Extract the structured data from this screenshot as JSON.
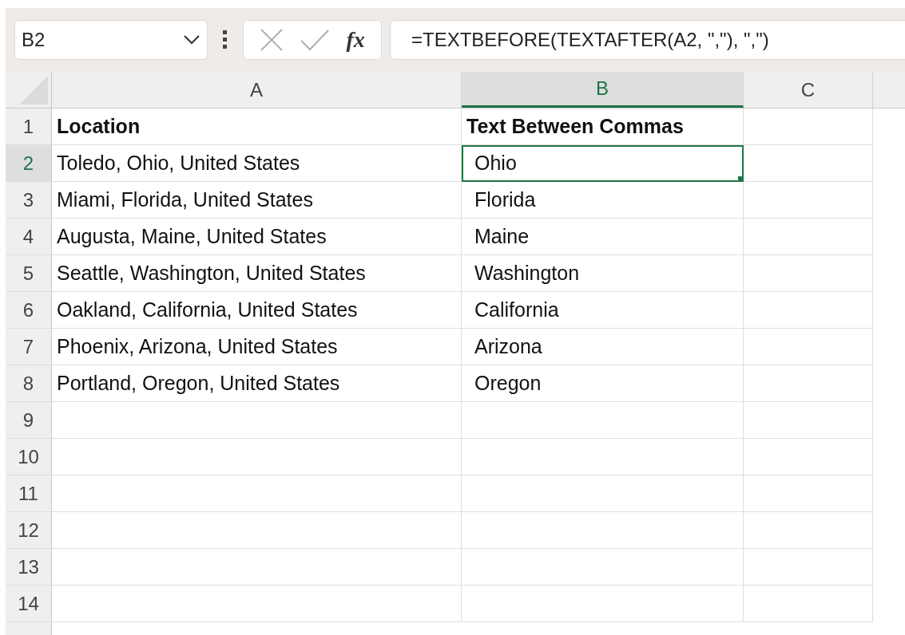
{
  "name_box": {
    "value": "B2"
  },
  "formula_bar": {
    "cancel_disabled": true,
    "enter_disabled": true,
    "function_label": "fx",
    "value": "=TEXTBEFORE(TEXTAFTER(A2, \",\"), \",\")"
  },
  "columns": [
    {
      "label": "A",
      "selected": false
    },
    {
      "label": "B",
      "selected": true
    },
    {
      "label": "C",
      "selected": false
    }
  ],
  "rows": [
    {
      "number": "1",
      "selected": false,
      "cells": [
        {
          "text": "Location",
          "selected": false,
          "bold": true
        },
        {
          "text": "Text Between Commas",
          "selected": false,
          "bold": true
        }
      ]
    },
    {
      "number": "2",
      "selected": true,
      "cells": [
        {
          "text": "Toledo, Ohio, United States",
          "selected": false,
          "bold": false
        },
        {
          "text": "Ohio",
          "selected": true,
          "bold": false
        }
      ]
    },
    {
      "number": "3",
      "selected": false,
      "cells": [
        {
          "text": "Miami, Florida, United States",
          "selected": false,
          "bold": false
        },
        {
          "text": "Florida",
          "selected": false,
          "bold": false
        }
      ]
    },
    {
      "number": "4",
      "selected": false,
      "cells": [
        {
          "text": "Augusta, Maine, United States",
          "selected": false,
          "bold": false
        },
        {
          "text": "Maine",
          "selected": false,
          "bold": false
        }
      ]
    },
    {
      "number": "5",
      "selected": false,
      "cells": [
        {
          "text": "Seattle, Washington, United States",
          "selected": false,
          "bold": false
        },
        {
          "text": "Washington",
          "selected": false,
          "bold": false
        }
      ]
    },
    {
      "number": "6",
      "selected": false,
      "cells": [
        {
          "text": "Oakland, California, United States",
          "selected": false,
          "bold": false
        },
        {
          "text": "California",
          "selected": false,
          "bold": false
        }
      ]
    },
    {
      "number": "7",
      "selected": false,
      "cells": [
        {
          "text": "Phoenix, Arizona, United States",
          "selected": false,
          "bold": false
        },
        {
          "text": "Arizona",
          "selected": false,
          "bold": false
        }
      ]
    },
    {
      "number": "8",
      "selected": false,
      "cells": [
        {
          "text": "Portland, Oregon, United States",
          "selected": false,
          "bold": false
        },
        {
          "text": "Oregon",
          "selected": false,
          "bold": false
        }
      ]
    },
    {
      "number": "9",
      "selected": false,
      "cells": []
    },
    {
      "number": "10",
      "selected": false,
      "cells": []
    },
    {
      "number": "11",
      "selected": false,
      "cells": []
    },
    {
      "number": "12",
      "selected": false,
      "cells": []
    },
    {
      "number": "13",
      "selected": false,
      "cells": []
    },
    {
      "number": "14",
      "selected": false,
      "cells": []
    }
  ]
}
